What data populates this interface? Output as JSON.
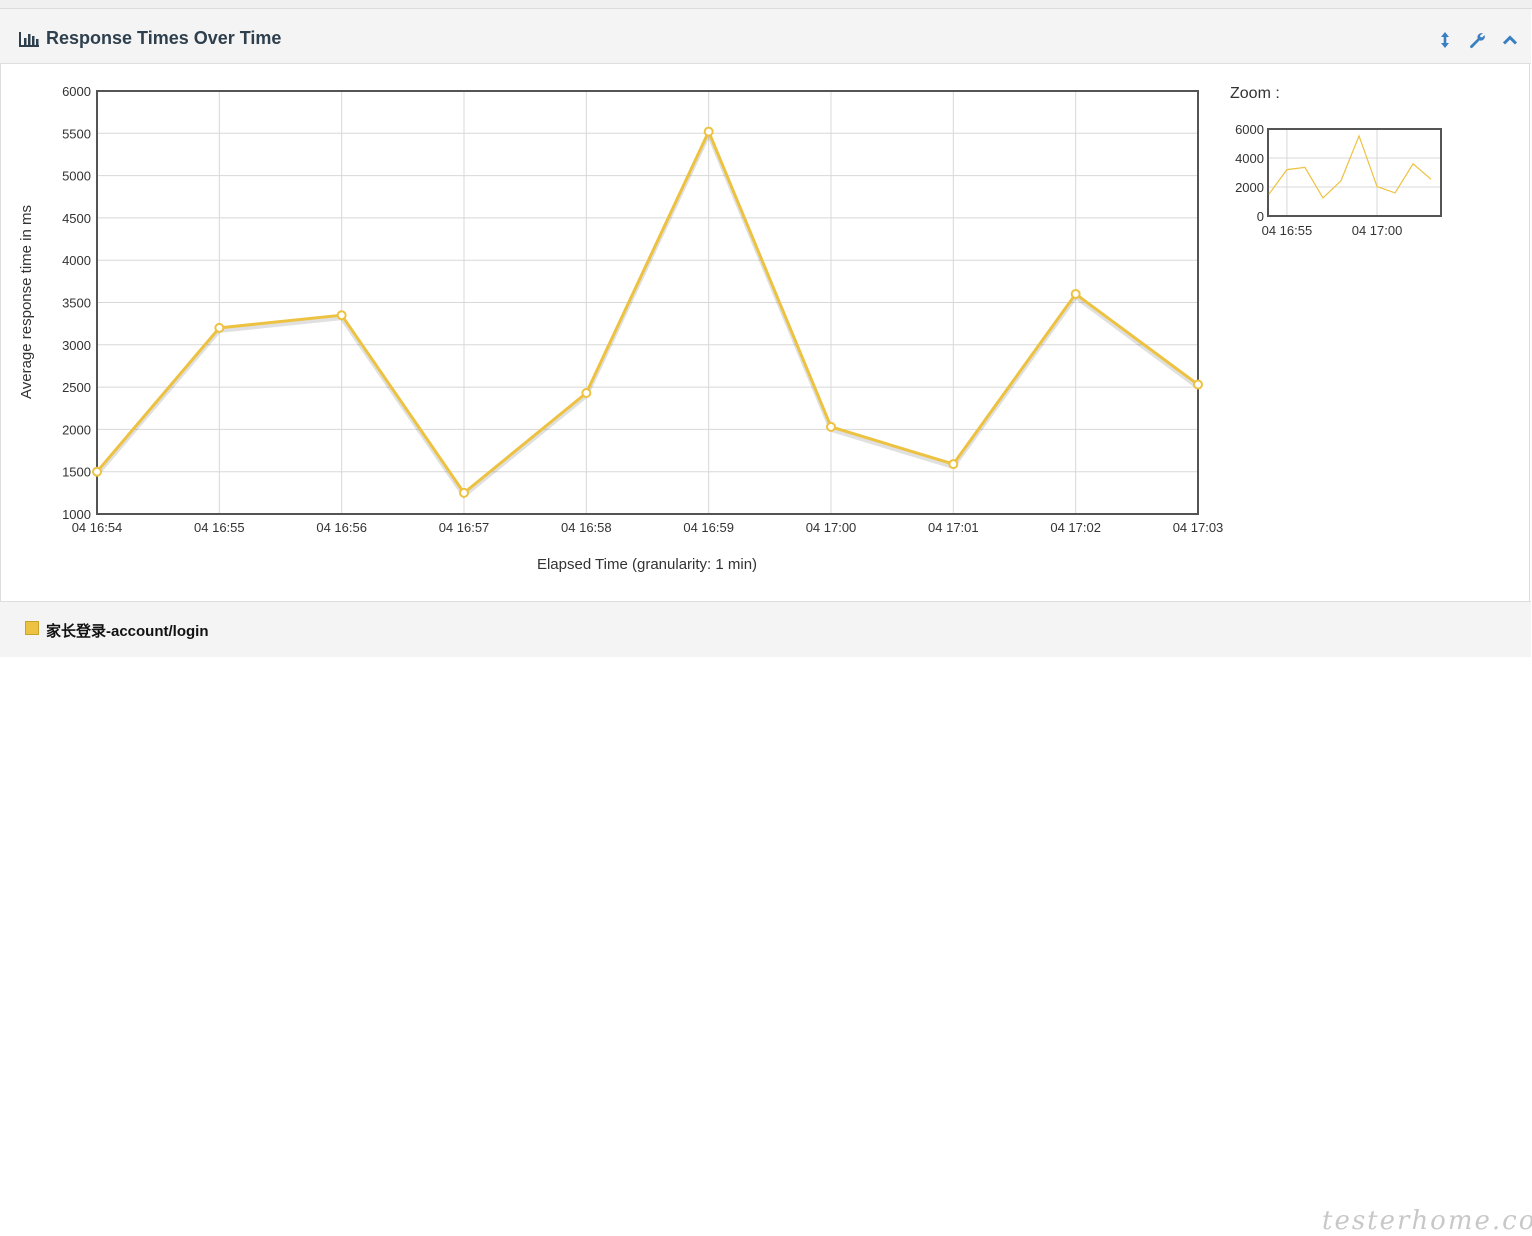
{
  "panel": {
    "title": "Response Times Over Time",
    "zoom_label": "Zoom :",
    "legend_label": "家长登录-account/login",
    "watermark": "testerhome.com",
    "icons": [
      "bar-chart-icon",
      "expand-vertical-icon",
      "wrench-icon",
      "chevron-up-icon"
    ]
  },
  "colors": {
    "series": "#edc240",
    "grid": "#d8d8d8",
    "axis_border": "#545454"
  },
  "chart_data": {
    "type": "line",
    "title": "",
    "xlabel": "Elapsed Time (granularity: 1 min)",
    "ylabel": "Average response time in ms",
    "categories": [
      "04 16:54",
      "04 16:55",
      "04 16:56",
      "04 16:57",
      "04 16:58",
      "04 16:59",
      "04 17:00",
      "04 17:01",
      "04 17:02",
      "04 17:03"
    ],
    "series": [
      {
        "name": "家长登录-account/login",
        "values": [
          1500,
          3200,
          3350,
          1250,
          2430,
          5520,
          2030,
          1590,
          3600,
          2530
        ]
      }
    ],
    "ylim": [
      1000,
      6000
    ],
    "yticks": [
      1000,
      1500,
      2000,
      2500,
      3000,
      3500,
      4000,
      4500,
      5000,
      5500,
      6000
    ],
    "grid": true,
    "legend": "bottom-left",
    "zoom": {
      "ylim": [
        0,
        6000
      ],
      "yticks": [
        0,
        2000,
        4000,
        6000
      ],
      "xticks": [
        "04 16:55",
        "04 17:00"
      ]
    }
  }
}
